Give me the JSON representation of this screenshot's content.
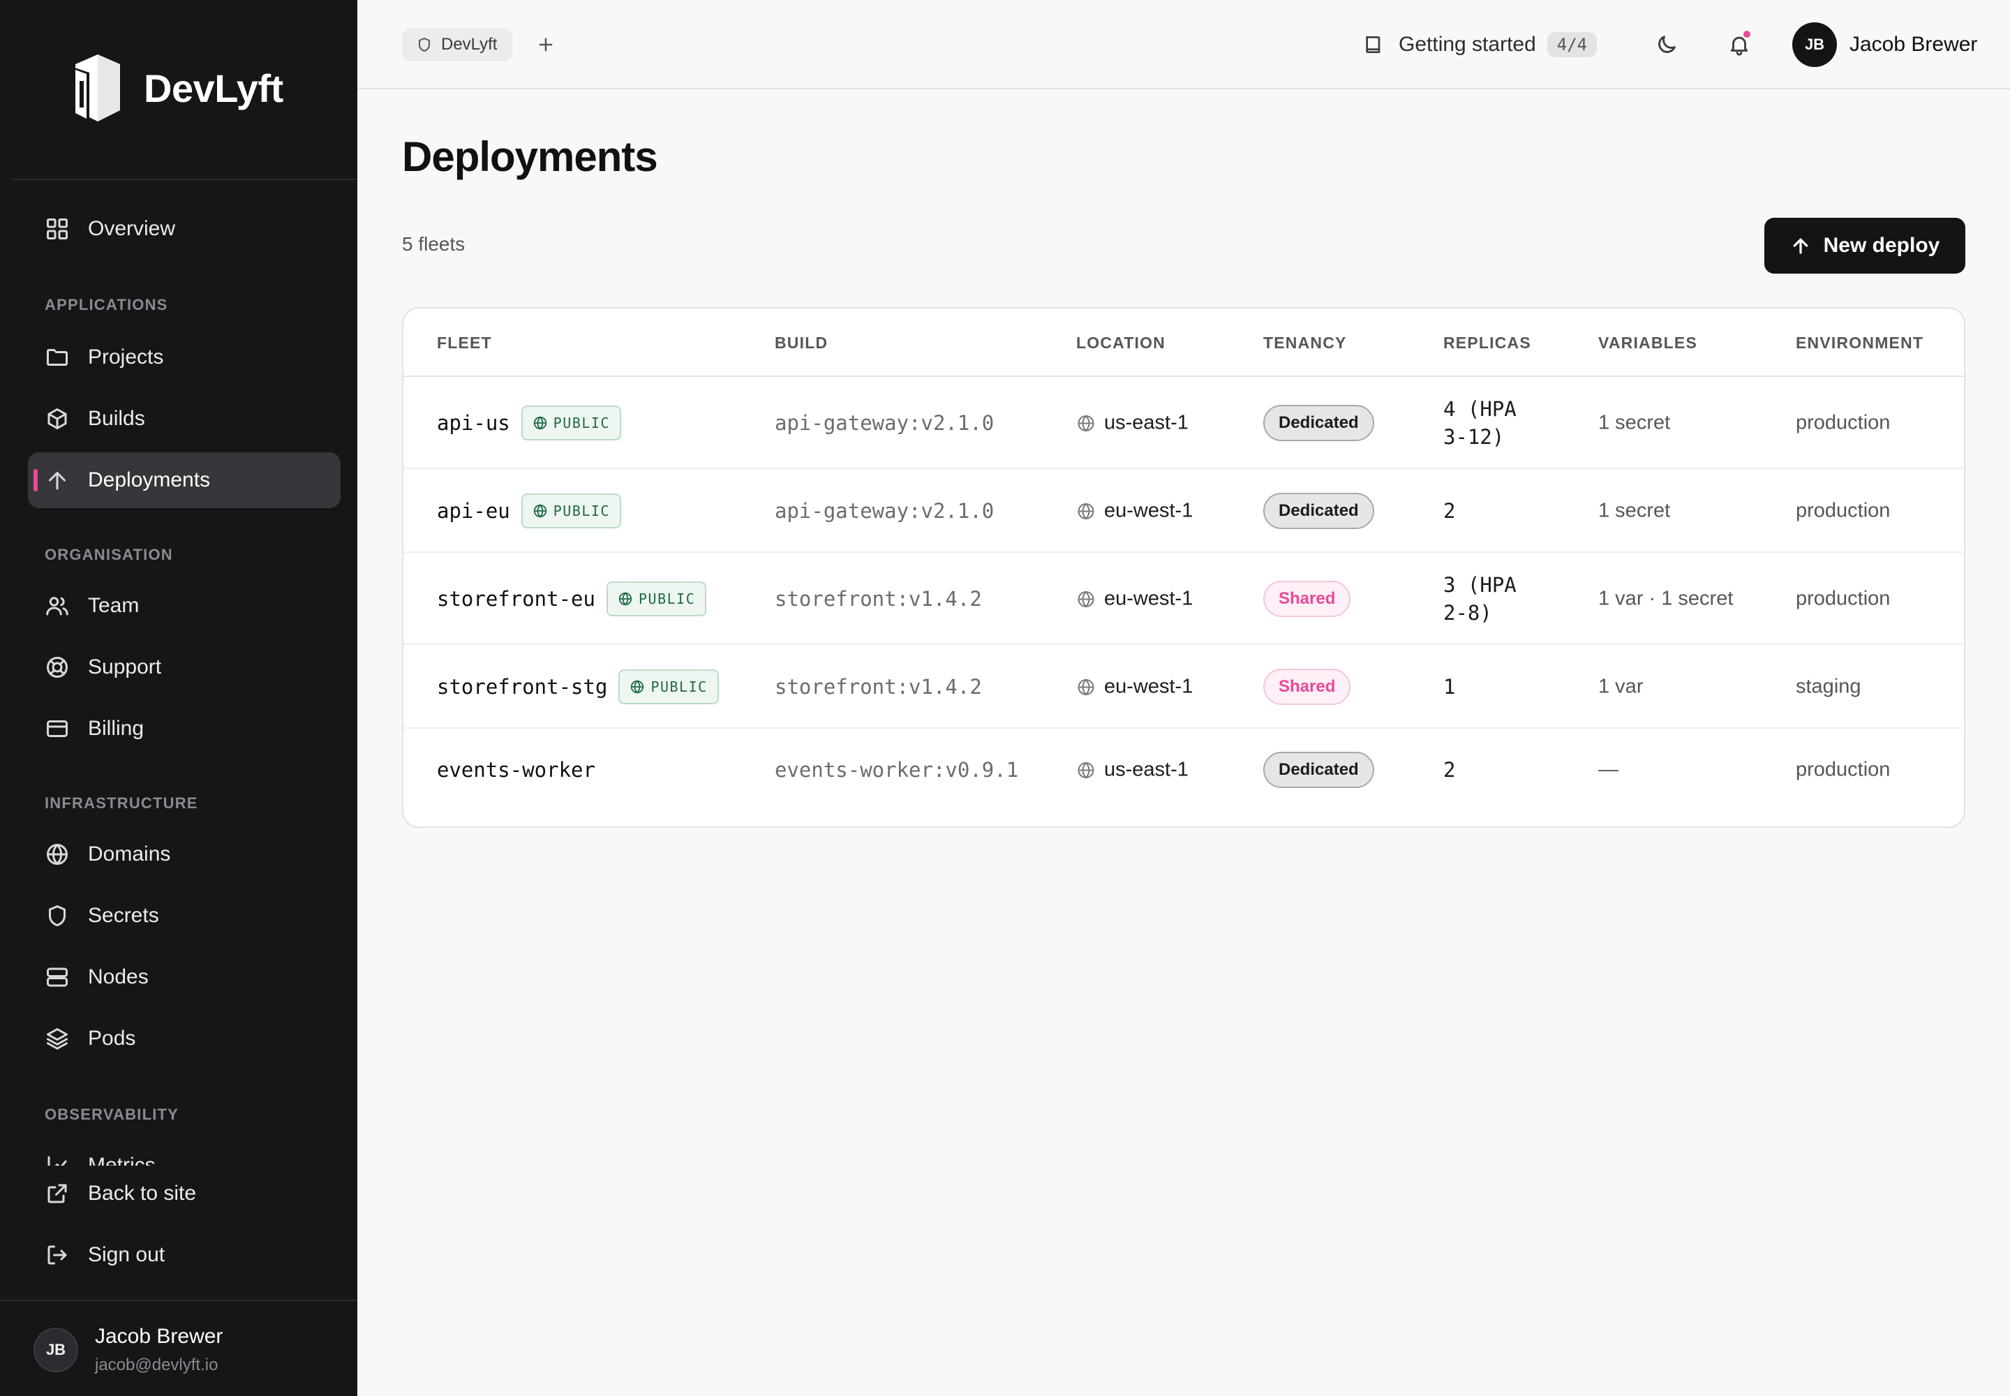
{
  "app": {
    "name": "DevLyft"
  },
  "sidebar": {
    "top_items": [
      {
        "label": "Overview",
        "icon": "grid-icon"
      }
    ],
    "sections": [
      {
        "label": "APPLICATIONS",
        "items": [
          {
            "label": "Projects",
            "icon": "folder-icon"
          },
          {
            "label": "Builds",
            "icon": "box-icon"
          },
          {
            "label": "Deployments",
            "icon": "arrow-up-icon",
            "active": true
          }
        ]
      },
      {
        "label": "ORGANISATION",
        "items": [
          {
            "label": "Team",
            "icon": "users-icon"
          },
          {
            "label": "Support",
            "icon": "lifebuoy-icon"
          },
          {
            "label": "Billing",
            "icon": "credit-card-icon"
          }
        ]
      },
      {
        "label": "INFRASTRUCTURE",
        "items": [
          {
            "label": "Domains",
            "icon": "globe-icon"
          },
          {
            "label": "Secrets",
            "icon": "shield-icon"
          },
          {
            "label": "Nodes",
            "icon": "server-icon"
          },
          {
            "label": "Pods",
            "icon": "layers-icon"
          }
        ]
      },
      {
        "label": "OBSERVABILITY",
        "items": [
          {
            "label": "Metrics",
            "icon": "chart-icon"
          }
        ]
      }
    ],
    "bottom_items": [
      {
        "label": "Back to site",
        "icon": "external-link-icon"
      },
      {
        "label": "Sign out",
        "icon": "log-out-icon"
      }
    ],
    "user": {
      "initials": "JB",
      "name": "Jacob Brewer",
      "email": "jacob@devlyft.io"
    }
  },
  "topbar": {
    "org_chip": "DevLyft",
    "getting_started": {
      "label": "Getting started",
      "progress": "4/4"
    },
    "user": {
      "initials": "JB",
      "name": "Jacob Brewer"
    },
    "notification_dot_color": "#ec4899"
  },
  "main": {
    "title": "Deployments",
    "count_text": "5 fleets",
    "new_deploy_label": "New deploy",
    "table": {
      "columns": [
        "FLEET",
        "BUILD",
        "LOCATION",
        "TENANCY",
        "REPLICAS",
        "VARIABLES",
        "ENVIRONMENT"
      ],
      "rows": [
        {
          "fleet": "api-us",
          "public": true,
          "public_label": "PUBLIC",
          "build": "api-gateway:v2.1.0",
          "location": "us-east-1",
          "tenancy": "Dedicated",
          "replicas_line1": "4 (HPA",
          "replicas_line2": "3-12)",
          "variables": "1 secret",
          "environment": "production"
        },
        {
          "fleet": "api-eu",
          "public": true,
          "public_label": "PUBLIC",
          "build": "api-gateway:v2.1.0",
          "location": "eu-west-1",
          "tenancy": "Dedicated",
          "replicas_line1": "2",
          "replicas_line2": "",
          "variables": "1 secret",
          "environment": "production"
        },
        {
          "fleet": "storefront-eu",
          "public": true,
          "public_label": "PUBLIC",
          "build": "storefront:v1.4.2",
          "location": "eu-west-1",
          "tenancy": "Shared",
          "replicas_line1": "3 (HPA",
          "replicas_line2": "2-8)",
          "variables": "1 var · 1 secret",
          "environment": "production"
        },
        {
          "fleet": "storefront-stg",
          "public": true,
          "public_label": "PUBLIC",
          "build": "storefront:v1.4.2",
          "location": "eu-west-1",
          "tenancy": "Shared",
          "replicas_line1": "1",
          "replicas_line2": "",
          "variables": "1 var",
          "environment": "staging"
        },
        {
          "fleet": "events-worker",
          "public": false,
          "public_label": "",
          "build": "events-worker:v0.9.1",
          "location": "us-east-1",
          "tenancy": "Dedicated",
          "replicas_line1": "2",
          "replicas_line2": "",
          "variables": "—",
          "environment": "production"
        }
      ]
    }
  },
  "colors": {
    "accent": "#ec4899",
    "sidebar_bg": "#161618",
    "public_green": "#1f6b43"
  }
}
